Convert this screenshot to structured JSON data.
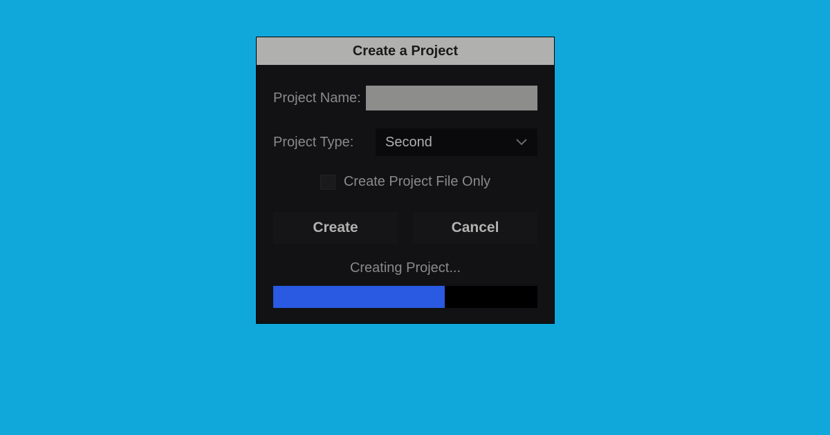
{
  "dialog": {
    "title": "Create a Project",
    "fields": {
      "name_label": "Project Name:",
      "name_value": "",
      "type_label": "Project Type:",
      "type_selected": "Second",
      "file_only_label": "Create Project File Only",
      "file_only_checked": false
    },
    "buttons": {
      "create": "Create",
      "cancel": "Cancel"
    },
    "status": {
      "text": "Creating Project...",
      "progress_percent": 65
    }
  },
  "colors": {
    "background": "#10a8da",
    "dialog_bg": "#121214",
    "titlebar_bg": "#b0b0af",
    "progress_fill": "#2a5ae1",
    "progress_track": "#000000"
  }
}
